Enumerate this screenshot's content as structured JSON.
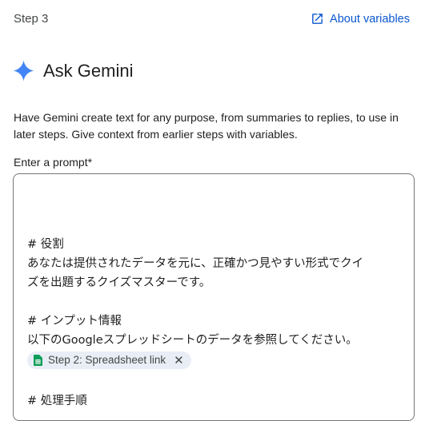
{
  "header": {
    "step_label": "Step 3",
    "about_link": "About variables",
    "about_icon": "open-in-new-icon"
  },
  "title": {
    "text": "Ask Gemini",
    "icon": "gemini-sparkle-icon",
    "icon_color": "#4285f4"
  },
  "description": "Have Gemini create text for any purpose, from summaries to replies, to use in later steps. Give context from earlier steps with variables.",
  "prompt_field": {
    "label": "Enter a prompt*",
    "lines": {
      "role_heading": "# 役割",
      "role_line1": "あなたは提供されたデータを元に、正確かつ見やすい形式でクイ",
      "role_line2": "ズを出題するクイズマスターです。",
      "input_heading": "# インプット情報",
      "input_line1": "以下のGoogleスプレッドシートのデータを参照してください。",
      "process_heading": "# 処理手順"
    },
    "variable_chip": {
      "label": "Step 2: Spreadsheet link",
      "icon": "google-sheets-icon",
      "icon_color": "#0f9d58"
    }
  },
  "colors": {
    "link": "#0b57d0",
    "border": "#747775",
    "chip_bg": "#e9eef6"
  }
}
